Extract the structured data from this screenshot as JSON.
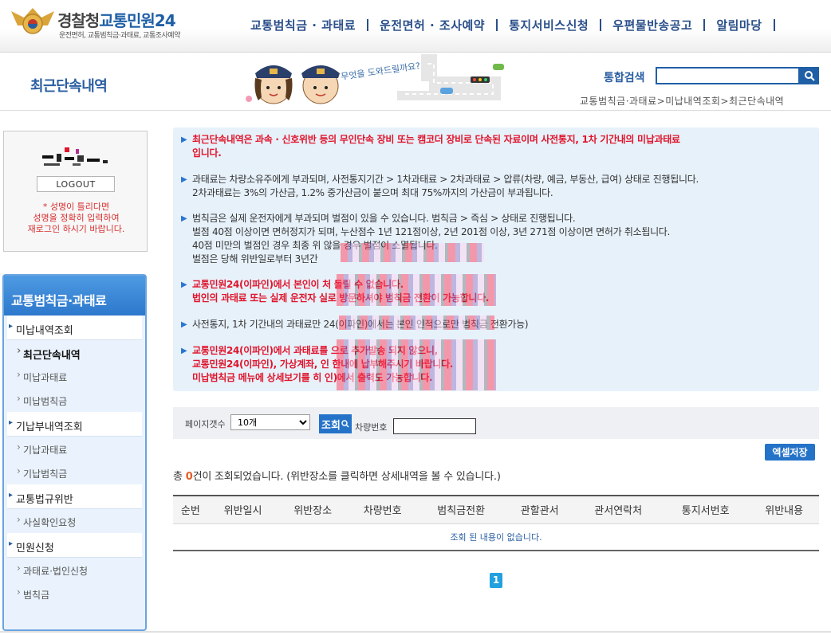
{
  "header": {
    "logo_title_a": "경찰청",
    "logo_title_b": "교통민원24",
    "logo_subtitle": "운전면허, 교통범칙금·과태료, 교통조사예약",
    "nav": [
      "교통범칙금 · 과태료",
      "운전면허 · 조사예약",
      "통지서비스신청",
      "우편물반송공고",
      "알림마당"
    ]
  },
  "page": {
    "title": "최근단속내역",
    "mascot_bubble": "무엇을 도와드릴까요?",
    "search_label": "통합검색",
    "search_value": "",
    "breadcrumb": "교통범칙금·과태료>미납내역조회>최근단속내역"
  },
  "login": {
    "logout_label": "LOGOUT",
    "warning": "* 성명이 틀리다면\n성명을 정확히 입력하여\n재로그인 하시기 바랍니다."
  },
  "sidemenu": {
    "heading": "교통범칙금·과태료",
    "items": [
      {
        "type": "group",
        "label": "미납내역조회"
      },
      {
        "type": "sub",
        "label": "최근단속내역",
        "active": true
      },
      {
        "type": "sub",
        "label": "미납과태료"
      },
      {
        "type": "sub",
        "label": "미납범칙금"
      },
      {
        "type": "group",
        "label": "기납부내역조회"
      },
      {
        "type": "sub",
        "label": "기납과태료"
      },
      {
        "type": "sub",
        "label": "기납범칙금"
      },
      {
        "type": "group",
        "label": "교통법규위반"
      },
      {
        "type": "sub",
        "label": "사실확인요청"
      },
      {
        "type": "group",
        "label": "민원신청"
      },
      {
        "type": "sub",
        "label": "과태료·법인신청"
      },
      {
        "type": "sub",
        "label": "범칙금"
      }
    ]
  },
  "info": {
    "p1": "최근단속내역은 과속 · 신호위반 등의 무인단속 장비 또는 캠코더 장비로 단속된 자료이며 사전통지, 1차 기간내의 미납과태료\n입니다.",
    "p2": "과태료는 차량소유주에게 부과되며, 사전통지기간 > 1차과태료 > 2차과태료 > 압류(차량, 예금, 부동산, 급여) 상태로 진행됩니다.\n2차과태료는 3%의 가산금, 1.2% 중가산금이 붙으며 최대 75%까지의 가산금이 부과됩니다.",
    "p3": "범칙금은 실제 운전자에게 부과되며 벌점이 있을 수 있습니다. 범칙금 > 즉심 > 상태로 진행됩니다.\n벌점 40점 이상이면 면허정지가 되며, 누산점수 1년 121점이상, 2년 201점 이상, 3년 271점 이상이면 면허가 취소됩니다.\n40점 미만의 벌점인 경우 최종 위                                                     않을 경우 벌점이 소멸됩니다.\n벌점은 당해 위반일로부터 3년간",
    "p4": "교통민원24(이파인)에서 본인이 처                                                         돌릴 수 없습니다.\n법인의 과태료 또는 실제 운전자                                                   실로 방문하셔야 범칙금 전환이 가능합니다.",
    "p5": "사전통지, 1차 기간내의 과태료만                                                     24(이파인)에서는 본인 인적으로만 범칙금 전환가능)",
    "p6": "교통민원24(이파인)에서 과태료를                                                  으로 추가발송 되지 않으니,\n교통민원24(이파인), 가상계좌, 인                                               한내에 납부해주시기 바랍니다.\n미납범칙금 메뉴에 상세보기를 히                                              인)에서 출력도 가능합니다."
  },
  "controls": {
    "page_size_label": "페이지갯수",
    "page_size_value": "10개",
    "query_label": "조회",
    "car_label": "차량번호",
    "excel_label": "엑셀저장"
  },
  "result": {
    "prefix": "총 ",
    "count": "0",
    "suffix": "건이 조회되었습니다. (위반장소를 클릭하면 상세내역을 볼 수 있습니다.)"
  },
  "table": {
    "columns": [
      "순번",
      "위반일시",
      "위반장소",
      "차량번호",
      "범칙금전환",
      "관할관서",
      "관서연락처",
      "통지서번호",
      "위반내용"
    ],
    "empty_message": "조회 된 내용이 없습니다."
  },
  "pager": {
    "current": "1"
  },
  "colors": {
    "brand_blue": "#1f5fa6",
    "accent_red": "#e0152c",
    "count_orange": "#e25d25",
    "info_bg": "#e7f1fa"
  }
}
